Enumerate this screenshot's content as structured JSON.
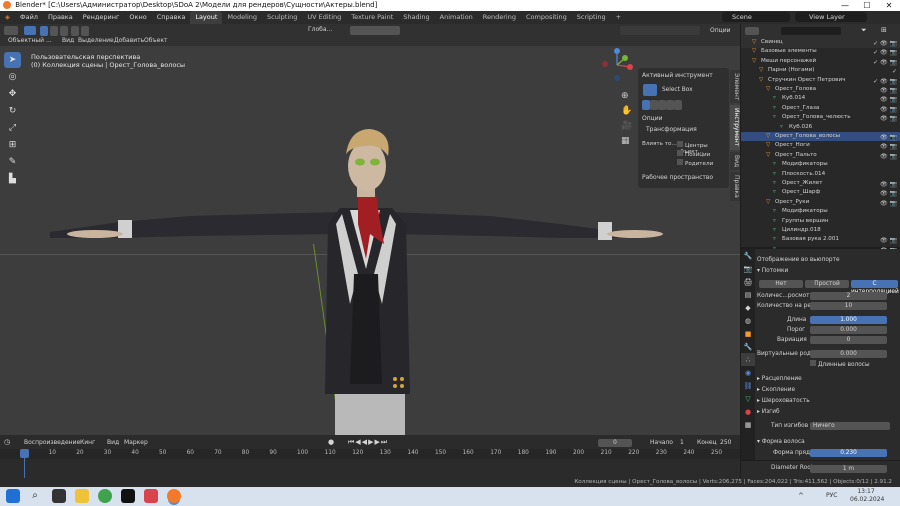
{
  "window": {
    "title": "Blender* [C:\\Users\\Администратор\\Desktop\\SDoA 2\\Модели для рендеров\\Сущности\\Актеры.blend]",
    "minimize": "—",
    "maximize": "☐",
    "close": "✕"
  },
  "menu": [
    "Файл",
    "Правка",
    "Рендеринг",
    "Окно",
    "Справка"
  ],
  "workspaces": [
    "Layout",
    "Modeling",
    "Sculpting",
    "UV Editing",
    "Texture Paint",
    "Shading",
    "Animation",
    "Rendering",
    "Compositing",
    "Scripting"
  ],
  "add_workspace": "+",
  "scene": {
    "name": "Scene",
    "view_layer": "View Layer"
  },
  "viewport_header": {
    "mode": "Объектный ...",
    "menus": [
      "Вид",
      "Выделение",
      "Добавить",
      "Объект"
    ],
    "transform_orientation": "Глоба...",
    "options": "Опции"
  },
  "viewport_overlay": {
    "line1": "Пользовательская перспектива",
    "line2": "(0) Коллекция сцены | Орест_Голова_волосы"
  },
  "npanel": {
    "active_tool": "Активный инструмент",
    "select_box": "Select Box",
    "options": "Опции",
    "transform": "Трансформация",
    "affect_label": "Влиять то...",
    "check1": "Центры объект...",
    "check2": "Позиции",
    "check3": "Родители",
    "workspace": "Рабочее пространство",
    "tabs": [
      "Элемент",
      "Инструмент",
      "Вид",
      "Правка"
    ]
  },
  "outliner": {
    "rows": [
      {
        "label": "Свинец",
        "depth": 1,
        "icons": "✓ 👁 📷"
      },
      {
        "label": "Базовые элементы",
        "depth": 1,
        "icons": "✓ 👁 📷"
      },
      {
        "label": "Меши персонажей",
        "depth": 1,
        "icons": "✓ 👁 📷"
      },
      {
        "label": "Парни (Ногами)",
        "depth": 2,
        "icons": "✓"
      },
      {
        "label": "Стручкин Орест Петрович",
        "depth": 2,
        "icons": "✓ 👁 📷"
      },
      {
        "label": "Орест_Голова",
        "depth": 3,
        "icons": "👁 📷"
      },
      {
        "label": "Куб.014",
        "depth": 4,
        "icons": "👁 📷"
      },
      {
        "label": "Орест_Глаза",
        "depth": 4,
        "icons": "👁 📷"
      },
      {
        "label": "Орест_Голова_челюсть",
        "depth": 4,
        "icons": "👁 📷"
      },
      {
        "label": "Куб.026",
        "depth": 5,
        "icons": ""
      },
      {
        "label": "Орест_Голова_волосы",
        "depth": 3,
        "icons": "👁 📷",
        "selected": true
      },
      {
        "label": "Орест_Ноги",
        "depth": 3,
        "icons": "👁 📷"
      },
      {
        "label": "Орест_Пальто",
        "depth": 3,
        "icons": "👁 📷"
      },
      {
        "label": "Модификаторы",
        "depth": 4,
        "icons": ""
      },
      {
        "label": "Плоскость.014",
        "depth": 4,
        "icons": ""
      },
      {
        "label": "Орест_Жилет",
        "depth": 4,
        "icons": "👁 📷"
      },
      {
        "label": "Орест_Шарф",
        "depth": 4,
        "icons": "👁 📷"
      },
      {
        "label": "Орест_Руки",
        "depth": 3,
        "icons": "👁 📷"
      },
      {
        "label": "Модификаторы",
        "depth": 4,
        "icons": ""
      },
      {
        "label": "Группы вершин",
        "depth": 4,
        "icons": ""
      },
      {
        "label": "Цилиндр.018",
        "depth": 4,
        "icons": ""
      },
      {
        "label": "Базовая рука 2.001",
        "depth": 4,
        "icons": "👁 📷"
      },
      {
        "label": "...",
        "depth": 4,
        "icons": "👁 📷"
      }
    ]
  },
  "properties": {
    "viewport_display": "Отображение во вьюпорте",
    "children": "Потомки",
    "child_modes": [
      "Нет",
      "Простой",
      "С интерполяцией"
    ],
    "child_mode_active": 2,
    "fields": [
      {
        "label": "Количес...росмотр",
        "value": "2"
      },
      {
        "label": "Количество на ре...",
        "value": "10"
      },
      {
        "label": "Длина",
        "value": "1.000",
        "blue": true
      },
      {
        "label": "Порог",
        "value": "0.000"
      },
      {
        "label": "Вариация",
        "value": "0"
      }
    ],
    "virtual_parents": {
      "label": "Виртуальные род...",
      "value": "0.000"
    },
    "long_hair": "Длинные волосы",
    "collapsed": [
      "Расцепление",
      "Скопление",
      "Шероховатость",
      "Изгиб"
    ],
    "bend_type_label": "Тип изгибов",
    "bend_type_value": "Ничего",
    "hair_shape": "Форма волоса",
    "tip_shape": {
      "label": "Форма пряди",
      "value": "0.230"
    },
    "diameter_root": {
      "label": "Diameter Root",
      "value": "1 m"
    }
  },
  "timeline": {
    "menus": [
      "Воспроизведение",
      "Кинг",
      "Вид",
      "Маркер"
    ],
    "current_frame": "0",
    "start_label": "Начало",
    "start": "1",
    "end_label": "Конец",
    "end": "250",
    "ticks": [
      "0",
      "10",
      "20",
      "30",
      "40",
      "50",
      "60",
      "70",
      "80",
      "90",
      "100",
      "110",
      "120",
      "130",
      "140",
      "150",
      "160",
      "170",
      "180",
      "190",
      "200",
      "210",
      "220",
      "230",
      "240",
      "250"
    ]
  },
  "status": {
    "stats": "Коллекция сцены | Орест_Голова_волосы | Verts:206,275 | Faces:204,022 | Tris:411,562 | Objects:0/12 | 2.91.2"
  },
  "taskbar": {
    "lang": "РУС",
    "time": "13:17",
    "date": "06.02.2024",
    "chevron": "^"
  },
  "colors": {
    "accent": "#4772b3",
    "viewport_bg": "#3d3d3d",
    "panel_bg": "#2b2b2b",
    "selection": "#334d80",
    "object_orange": "#f49b30"
  }
}
